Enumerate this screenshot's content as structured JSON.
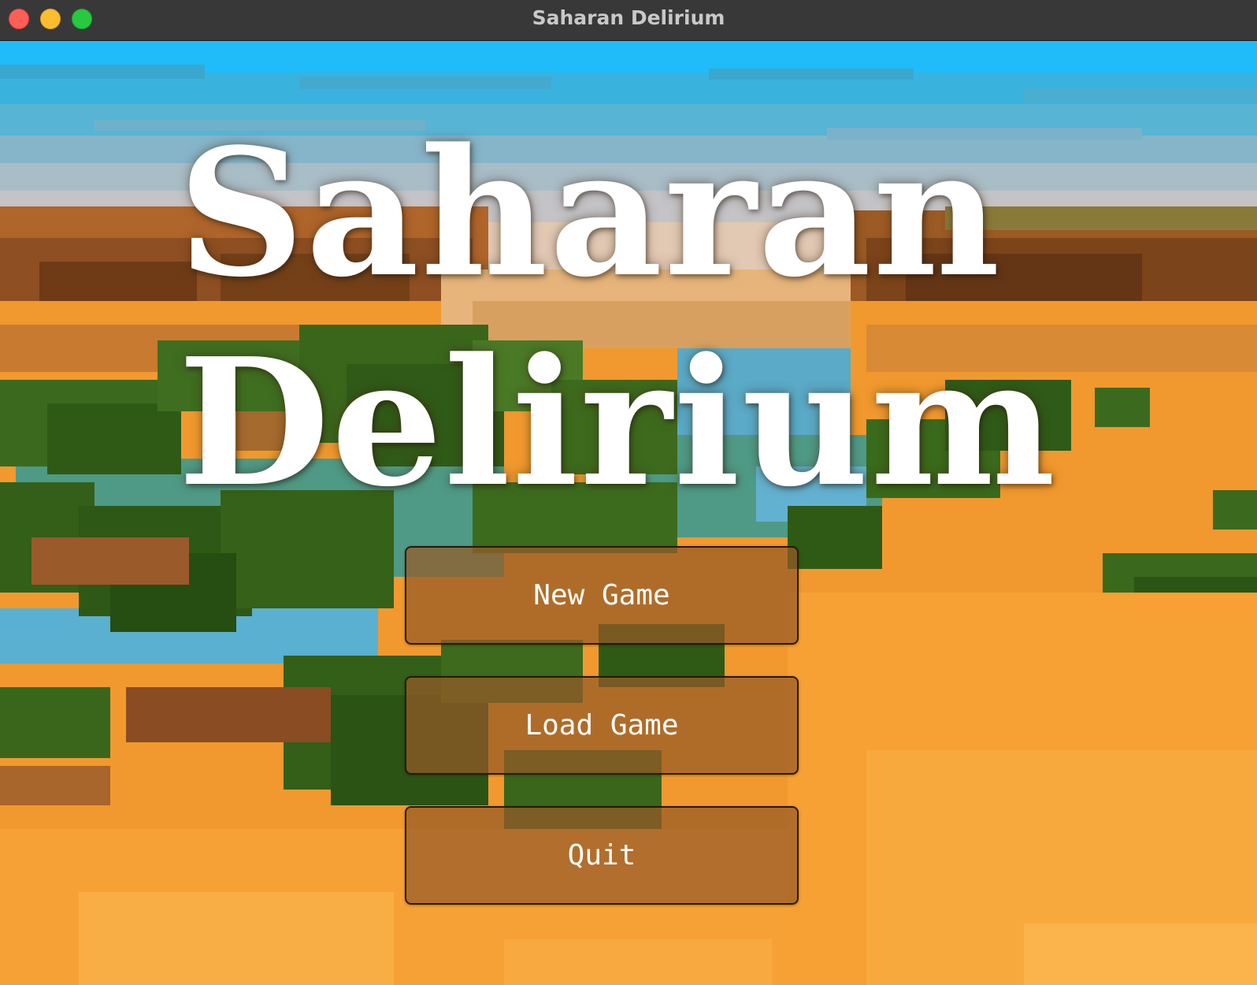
{
  "window": {
    "title": "Saharan Delirium"
  },
  "game": {
    "title_line1": "Saharan",
    "title_line2": "Delirium"
  },
  "menu": {
    "new_game": "New Game",
    "load_game": "Load Game",
    "quit": "Quit"
  },
  "colors": {
    "sky": "#1fbcf9",
    "sand": "#f7a033",
    "rock": "#8a4a1e",
    "water": "#54abc6",
    "foliage": "#3d6a1c",
    "button_fill": "#965a28",
    "title_text": "#ffffff"
  }
}
